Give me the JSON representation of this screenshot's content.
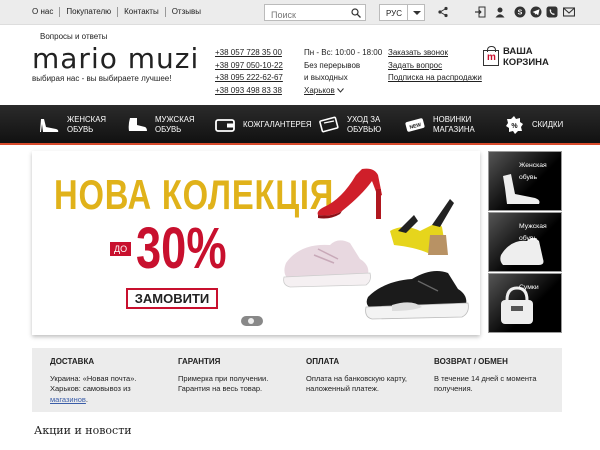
{
  "topbar": {
    "links": [
      "О нас",
      "Покупателю",
      "Контакты",
      "Отзывы"
    ],
    "search_placeholder": "Поиск",
    "language": "РУС",
    "icons": [
      "share-icon",
      "login-icon",
      "user-icon",
      "skype-icon",
      "telegram-icon",
      "viber-icon",
      "mail-icon"
    ]
  },
  "header": {
    "faq": "Вопросы и ответы",
    "logo": "mario muzi",
    "slogan": "выбирая нас - вы выбираете лучшее!",
    "phones": [
      "+38 057 728 35 00",
      "+38 097 050-10-22",
      "+38 095 222-62-67",
      "+38 093 498 83 38"
    ],
    "hours": [
      "Пн - Вс: 10:00 - 18:00",
      "Без перерывов",
      "и выходных"
    ],
    "city": "Харьков",
    "links": [
      "Заказать звонок",
      "Задать вопрос",
      "Подписка на распродажи"
    ],
    "cart": "ВАША КОРЗИНА",
    "cart_icon_letter": "m"
  },
  "nav": {
    "items": [
      {
        "l1": "ЖЕНСКАЯ",
        "l2": "ОБУВЬ",
        "icon": "womens-shoe-icon"
      },
      {
        "l1": "МУЖСКАЯ",
        "l2": "ОБУВЬ",
        "icon": "mens-shoe-icon"
      },
      {
        "l1": "КОЖГАЛАНТЕРЕЯ",
        "l2": "",
        "icon": "wallet-icon"
      },
      {
        "l1": "УХОД ЗА",
        "l2": "ОБУВЬЮ",
        "icon": "shoe-care-icon"
      },
      {
        "l1": "НОВИНКИ",
        "l2": "МАГАЗИНА",
        "icon": "new-tag-icon"
      },
      {
        "l1": "СКИДКИ",
        "l2": "",
        "icon": "discount-icon"
      }
    ],
    "accent": "#d84b2c"
  },
  "banner": {
    "title": "НОВА КОЛЕКЦІЯ",
    "do": "ДО",
    "discount": "30%",
    "button": "ЗАМОВИТИ",
    "title_color": "#e0b21a",
    "red": "#c8102e"
  },
  "side": {
    "items": [
      {
        "l1": "Женская",
        "l2": "обувь"
      },
      {
        "l1": "Мужская",
        "l2": "обувь"
      },
      {
        "l1": "Сумки",
        "l2": ""
      }
    ]
  },
  "info": {
    "cols": [
      {
        "h": "ДОСТАВКА",
        "lines": [
          "Украина: «Новая почта».",
          "Харьков: самовывоз из"
        ],
        "link": "магазинов",
        "after": "."
      },
      {
        "h": "ГАРАНТИЯ",
        "lines": [
          "Примерка при получении.",
          "Гарантия на весь товар."
        ]
      },
      {
        "h": "ОПЛАТА",
        "lines": [
          "Оплата на банковскую карту,",
          "наложенный платеж."
        ]
      },
      {
        "h": "ВОЗВРАТ / ОБМЕН",
        "lines": [
          "В течение 14 дней с момента",
          "получения."
        ]
      }
    ]
  },
  "news_title": "Акции и новости"
}
